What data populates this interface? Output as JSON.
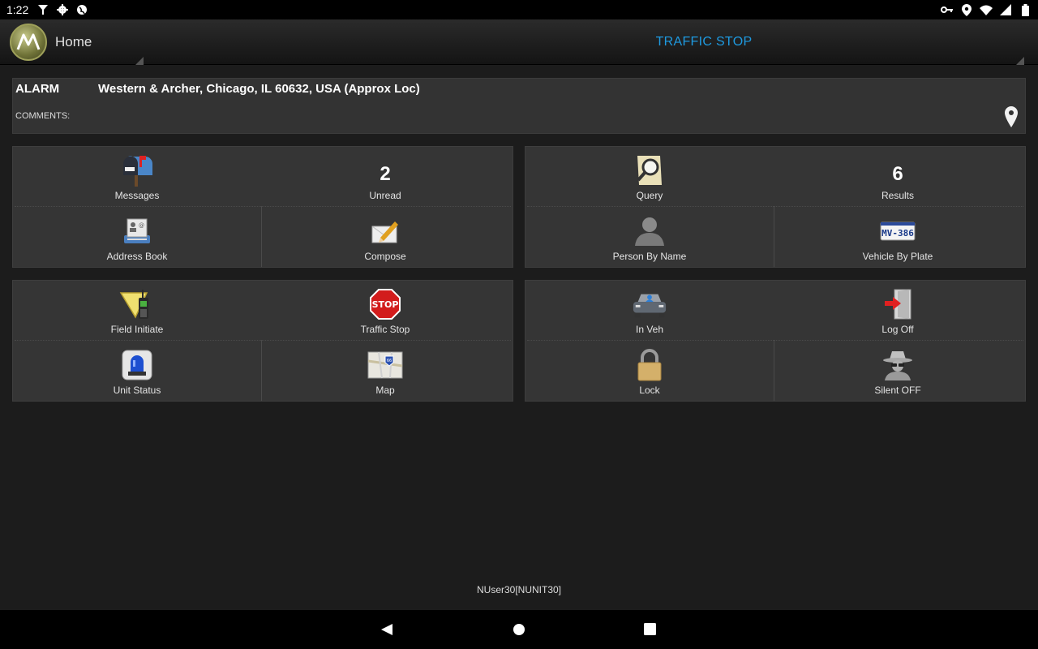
{
  "status_bar": {
    "time": "1:22",
    "left_icons": [
      "wifi-hotspot-icon",
      "settings-gear-icon",
      "globe-icon"
    ],
    "right_icons": [
      "vpn-key-icon",
      "location-icon",
      "wifi-icon",
      "signal-icon",
      "battery-icon"
    ]
  },
  "action_bar": {
    "home_label": "Home",
    "title": "TRAFFIC STOP",
    "title_color": "#1e9ae0"
  },
  "alarm": {
    "type": "ALARM",
    "address": "Western & Archer, Chicago, IL 60632, USA (Approx Loc)",
    "comments_label": "COMMENTS:"
  },
  "panels": {
    "messaging": {
      "messages": "Messages",
      "unread_count": "2",
      "unread_label": "Unread",
      "address_book": "Address Book",
      "compose": "Compose"
    },
    "query": {
      "query": "Query",
      "results_count": "6",
      "results_label": "Results",
      "person_by_name": "Person By Name",
      "vehicle_by_plate": "Vehicle By Plate",
      "plate_text": "MV-386"
    },
    "incidents": {
      "field_initiate": "Field Initiate",
      "traffic_stop": "Traffic Stop",
      "stop_sign_text": "STOP",
      "unit_status": "Unit Status",
      "map": "Map",
      "map_shield_text": "66"
    },
    "unit": {
      "in_veh": "In Veh",
      "log_off": "Log Off",
      "lock": "Lock",
      "silent": "Silent OFF"
    }
  },
  "footer": {
    "user": "NUser30[NUNIT30]"
  },
  "nav_bar": {
    "buttons": [
      "back-icon",
      "home-circle-icon",
      "recents-square-icon"
    ]
  }
}
